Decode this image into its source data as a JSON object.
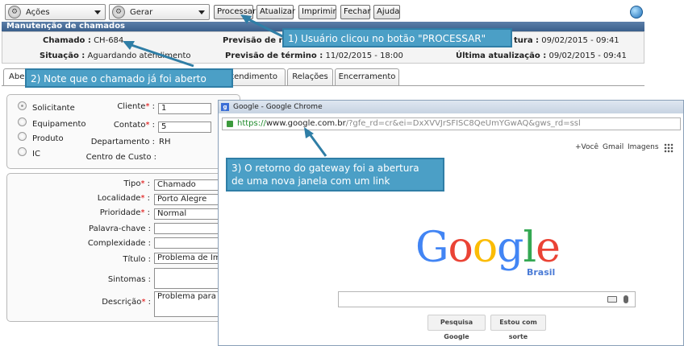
{
  "toolbar": {
    "acoes_label": "Ações",
    "gerar_label": "Gerar",
    "buttons": [
      "Processar",
      "Atualizar",
      "Imprimir",
      "Fechar",
      "Ajuda"
    ]
  },
  "header": {
    "title": "Manutenção de chamados",
    "chamado_label": "Chamado :",
    "chamado_value": "CH-684",
    "situacao_label": "Situação :",
    "situacao_value": "Aguardando atendimento",
    "previsao_re_label": "Previsão de re",
    "previsao_termino_label": "Previsão de término :",
    "previsao_termino_value": "11/02/2015 - 18:00",
    "abertura_label": "tura :",
    "abertura_value": "09/02/2015 - 09:41",
    "ultima_label": "Última atualização :",
    "ultima_value": "09/02/2015 - 09:41"
  },
  "tabs": [
    "Abe",
    "atendimento",
    "Relações",
    "Encerramento"
  ],
  "tipo_group": {
    "options": [
      "Solicitante",
      "Equipamento",
      "Produto",
      "IC"
    ],
    "cliente_label": "Cliente",
    "cliente_value": "1",
    "contato_label": "Contato",
    "contato_value": "5",
    "departamento_label": "Departamento :",
    "departamento_value": "RH",
    "centro_label": "Centro de Custo :"
  },
  "details": {
    "tipo_label": "Tipo",
    "tipo_value": "Chamado",
    "localidade_label": "Localidade",
    "localidade_value": "Porto Alegre",
    "prioridade_label": "Prioridade",
    "prioridade_value": "Normal",
    "palavra_label": "Palavra-chave :",
    "complexidade_label": "Complexidade :",
    "titulo_label": "Título :",
    "titulo_value": "Problema de Imp",
    "sintomas_label": "Sintomas :",
    "descricao_label": "Descrição",
    "descricao_value": "Problema para im"
  },
  "chrome": {
    "window_title": "Google - Google Chrome",
    "favicon_letter": "g",
    "url_scheme": "https://",
    "url_host": "www.google.com.br",
    "url_rest": "/?gfe_rd=cr&ei=DxXVVJrSFISC8QeUmYGwAQ&gws_rd=ssl",
    "links": [
      "+Você",
      "Gmail",
      "Imagens"
    ],
    "logo_letters": [
      "G",
      "o",
      "o",
      "g",
      "l",
      "e"
    ],
    "logo_sub": "Brasil",
    "search_button": "Pesquisa Google",
    "lucky_button": "Estou com sorte"
  },
  "annotations": {
    "note1": "1) Usuário clicou no botão \"PROCESSAR\"",
    "note2": "2) Note que o chamado já foi aberto",
    "note3_line1": "3) O retorno do gateway foi a abertura",
    "note3_line2": "de uma nova janela com um link"
  },
  "colors": {
    "header_blue": "#3b5f8b",
    "callout": "#4b9fc6",
    "google_blue": "#4285f4",
    "google_red": "#ea4335",
    "google_yellow": "#fbbc05",
    "google_green": "#34a853",
    "required": "#dd0000"
  }
}
